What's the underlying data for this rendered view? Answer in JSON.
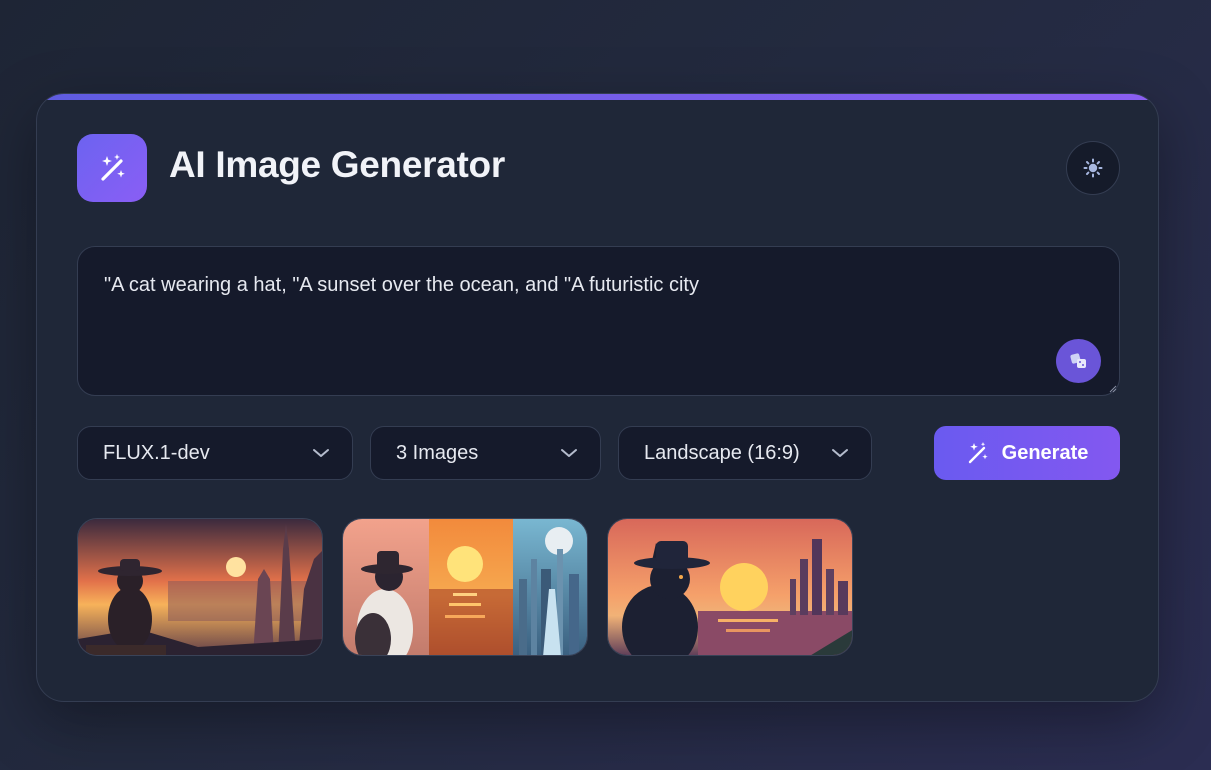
{
  "app": {
    "title": "AI Image Generator",
    "logo_icon": "magic-wand-icon",
    "theme_toggle_icon": "sun-icon"
  },
  "prompt": {
    "value": "\"A cat wearing a hat, \"A sunset over the ocean, and \"A futuristic city",
    "random_button_icon": "dice-icon"
  },
  "controls": {
    "model": {
      "selected": "FLUX.1-dev"
    },
    "image_count": {
      "selected": "3 Images"
    },
    "aspect_ratio": {
      "selected": "Landscape (16:9)"
    },
    "generate_label": "Generate"
  },
  "gallery": {
    "images": [
      {
        "description": "cat in hat overlooking sunset coast and spired city"
      },
      {
        "description": "three-panel: cat in hat, ocean sunset, futuristic city"
      },
      {
        "description": "silhouette cat in hat with sunset city skyline"
      }
    ]
  },
  "colors": {
    "accent": "#6c5ce7",
    "accent_end": "#8a5ef0",
    "card_bg": "#1f2738",
    "input_bg": "#151a2b"
  }
}
